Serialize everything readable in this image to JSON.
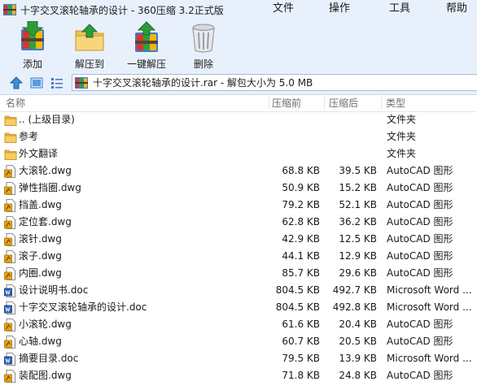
{
  "window": {
    "title": "十字交叉滚轮轴承的设计 - 360压缩 3.2正式版"
  },
  "menu": {
    "file": "文件",
    "operations": "操作",
    "tools": "工具",
    "help": "帮助"
  },
  "toolbar": {
    "add": "添加",
    "extract_to": "解压到",
    "one_click_extract": "一键解压",
    "delete": "删除"
  },
  "addressbar": {
    "path": "十字交叉滚轮轴承的设计.rar - 解包大小为 5.0 MB"
  },
  "columns": {
    "name": "名称",
    "size": "压缩前",
    "packed": "压缩后",
    "type": "类型"
  },
  "colors": {
    "chrome_bg": "#e8f0fb",
    "folder": "#f2c14e",
    "dwg_icon": "#e6a417",
    "doc_icon": "#2b5fad"
  },
  "files": [
    {
      "name": ".. (上级目录)",
      "size": "",
      "packed": "",
      "type": "文件夹",
      "icon": "folder-icon"
    },
    {
      "name": "参考",
      "size": "",
      "packed": "",
      "type": "文件夹",
      "icon": "folder-icon"
    },
    {
      "name": "外文翻译",
      "size": "",
      "packed": "",
      "type": "文件夹",
      "icon": "folder-icon"
    },
    {
      "name": "大滚轮.dwg",
      "size": "68.8 KB",
      "packed": "39.5 KB",
      "type": "AutoCAD 图形",
      "icon": "dwg-file-icon"
    },
    {
      "name": "弹性挡圈.dwg",
      "size": "50.9 KB",
      "packed": "15.2 KB",
      "type": "AutoCAD 图形",
      "icon": "dwg-file-icon"
    },
    {
      "name": "挡盖.dwg",
      "size": "79.2 KB",
      "packed": "52.1 KB",
      "type": "AutoCAD 图形",
      "icon": "dwg-file-icon"
    },
    {
      "name": "定位套.dwg",
      "size": "62.8 KB",
      "packed": "36.2 KB",
      "type": "AutoCAD 图形",
      "icon": "dwg-file-icon"
    },
    {
      "name": "滚针.dwg",
      "size": "42.9 KB",
      "packed": "12.5 KB",
      "type": "AutoCAD 图形",
      "icon": "dwg-file-icon"
    },
    {
      "name": "滚子.dwg",
      "size": "44.1 KB",
      "packed": "12.9 KB",
      "type": "AutoCAD 图形",
      "icon": "dwg-file-icon"
    },
    {
      "name": "内圈.dwg",
      "size": "85.7 KB",
      "packed": "29.6 KB",
      "type": "AutoCAD 图形",
      "icon": "dwg-file-icon"
    },
    {
      "name": "设计说明书.doc",
      "size": "804.5 KB",
      "packed": "492.7 KB",
      "type": "Microsoft Word ...",
      "icon": "word-doc-icon"
    },
    {
      "name": "十字交叉滚轮轴承的设计.doc",
      "size": "804.5 KB",
      "packed": "492.8 KB",
      "type": "Microsoft Word ...",
      "icon": "word-doc-icon"
    },
    {
      "name": "小滚轮.dwg",
      "size": "61.6 KB",
      "packed": "20.4 KB",
      "type": "AutoCAD 图形",
      "icon": "dwg-file-icon"
    },
    {
      "name": "心轴.dwg",
      "size": "60.7 KB",
      "packed": "20.5 KB",
      "type": "AutoCAD 图形",
      "icon": "dwg-file-icon"
    },
    {
      "name": "摘要目录.doc",
      "size": "79.5 KB",
      "packed": "13.9 KB",
      "type": "Microsoft Word ...",
      "icon": "word-doc-icon"
    },
    {
      "name": "装配图.dwg",
      "size": "71.8 KB",
      "packed": "24.8 KB",
      "type": "AutoCAD 图形",
      "icon": "dwg-file-icon"
    }
  ]
}
